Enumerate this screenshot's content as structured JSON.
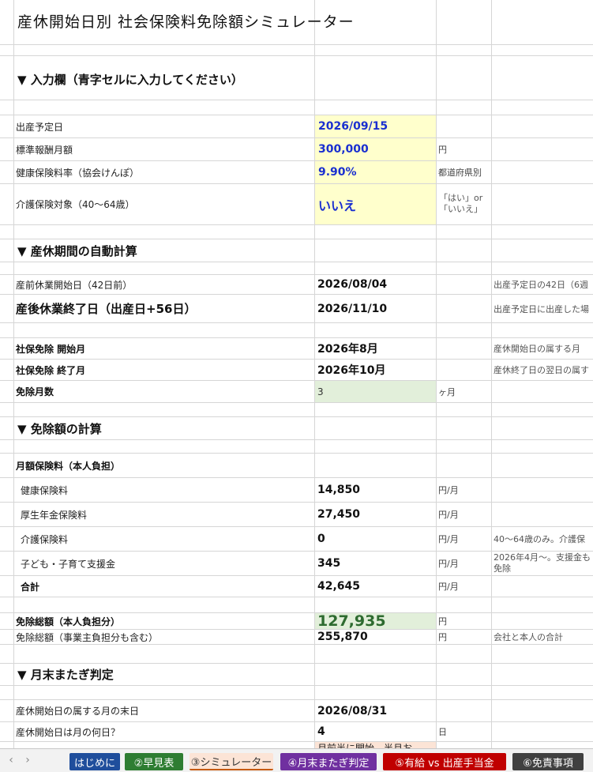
{
  "title": "産休開始日別 社会保険料免除額シミュレーター",
  "sections": {
    "input": "▼ 入力欄（青字セルに入力してください）",
    "period": "▼ 産休期間の自動計算",
    "exemption": "▼ 免除額の計算",
    "month_end": "▼ 月末またぎ判定"
  },
  "input": {
    "due_date_label": "出産予定日",
    "due_date_value": "2026/09/15",
    "salary_label": "標準報酬月額",
    "salary_value": "300,000",
    "salary_unit": "円",
    "health_rate_label": "健康保険料率（協会けんぽ）",
    "health_rate_value": "9.90%",
    "health_rate_note": "都道府県別",
    "care_label": "介護保険対象（40〜64歳）",
    "care_value": "いいえ",
    "care_note_line1": "「はい」or",
    "care_note_line2": "「いいえ」"
  },
  "period": {
    "prenatal_start_label": "産前休業開始日（42日前）",
    "prenatal_start_value": "2026/08/04",
    "prenatal_start_note": "出産予定日の42日（6週",
    "postnatal_end_label": "産後休業終了日（出産日+56日）",
    "postnatal_end_value": "2026/11/10",
    "postnatal_end_note": "出産予定日に出産した場",
    "exempt_start_label": "社保免除 開始月",
    "exempt_start_value": "2026年8月",
    "exempt_start_note": "産休開始日の属する月",
    "exempt_end_label": "社保免除 終了月",
    "exempt_end_value": "2026年10月",
    "exempt_end_note": "産休終了日の翌日の属す",
    "exempt_months_label": "免除月数",
    "exempt_months_value": "3",
    "exempt_months_unit": "ヶ月"
  },
  "exemption": {
    "monthly_header": "月額保険料（本人負担）",
    "rows": [
      {
        "label": "健康保険料",
        "value": "14,850",
        "unit": "円/月",
        "note": ""
      },
      {
        "label": "厚生年金保険料",
        "value": "27,450",
        "unit": "円/月",
        "note": ""
      },
      {
        "label": "介護保険料",
        "value": "0",
        "unit": "円/月",
        "note": "40〜64歳のみ。介護保"
      },
      {
        "label": "子ども・子育て支援金",
        "value": "345",
        "unit": "円/月",
        "note": "2026年4月〜。支援金も",
        "note2": "免除"
      },
      {
        "label": "合計",
        "value": "42,645",
        "unit": "円/月",
        "note": ""
      }
    ],
    "total_self_label": "免除総額（本人負担分）",
    "total_self_value": "127,935",
    "total_self_unit": "円",
    "total_all_label": "免除総額（事業主負担分も含む）",
    "total_all_value": "255,870",
    "total_all_unit": "円",
    "total_all_note": "会社と本人の合計"
  },
  "month_end": {
    "last_day_label": "産休開始日の属する月の末日",
    "last_day_value": "2026/08/31",
    "day_of_month_label": "産休開始日は月の何日？",
    "day_of_month_value": "4",
    "day_of_month_unit": "日",
    "partial_value": "月前半に開始。半月お"
  },
  "tabs": [
    {
      "label": "はじめに",
      "color": "#1f4e9c"
    },
    {
      "label": "②早見表",
      "color": "#2e7d32"
    },
    {
      "label": "③シミュレーター",
      "color": "#fce4d6"
    },
    {
      "label": "④月末またぎ判定",
      "color": "#7030a0"
    },
    {
      "label": "⑤有給 vs 出産手当金",
      "color": "#c00000"
    },
    {
      "label": "⑥免責事項",
      "color": "#404040"
    }
  ],
  "nav": {
    "prev": "‹",
    "next": "›"
  }
}
